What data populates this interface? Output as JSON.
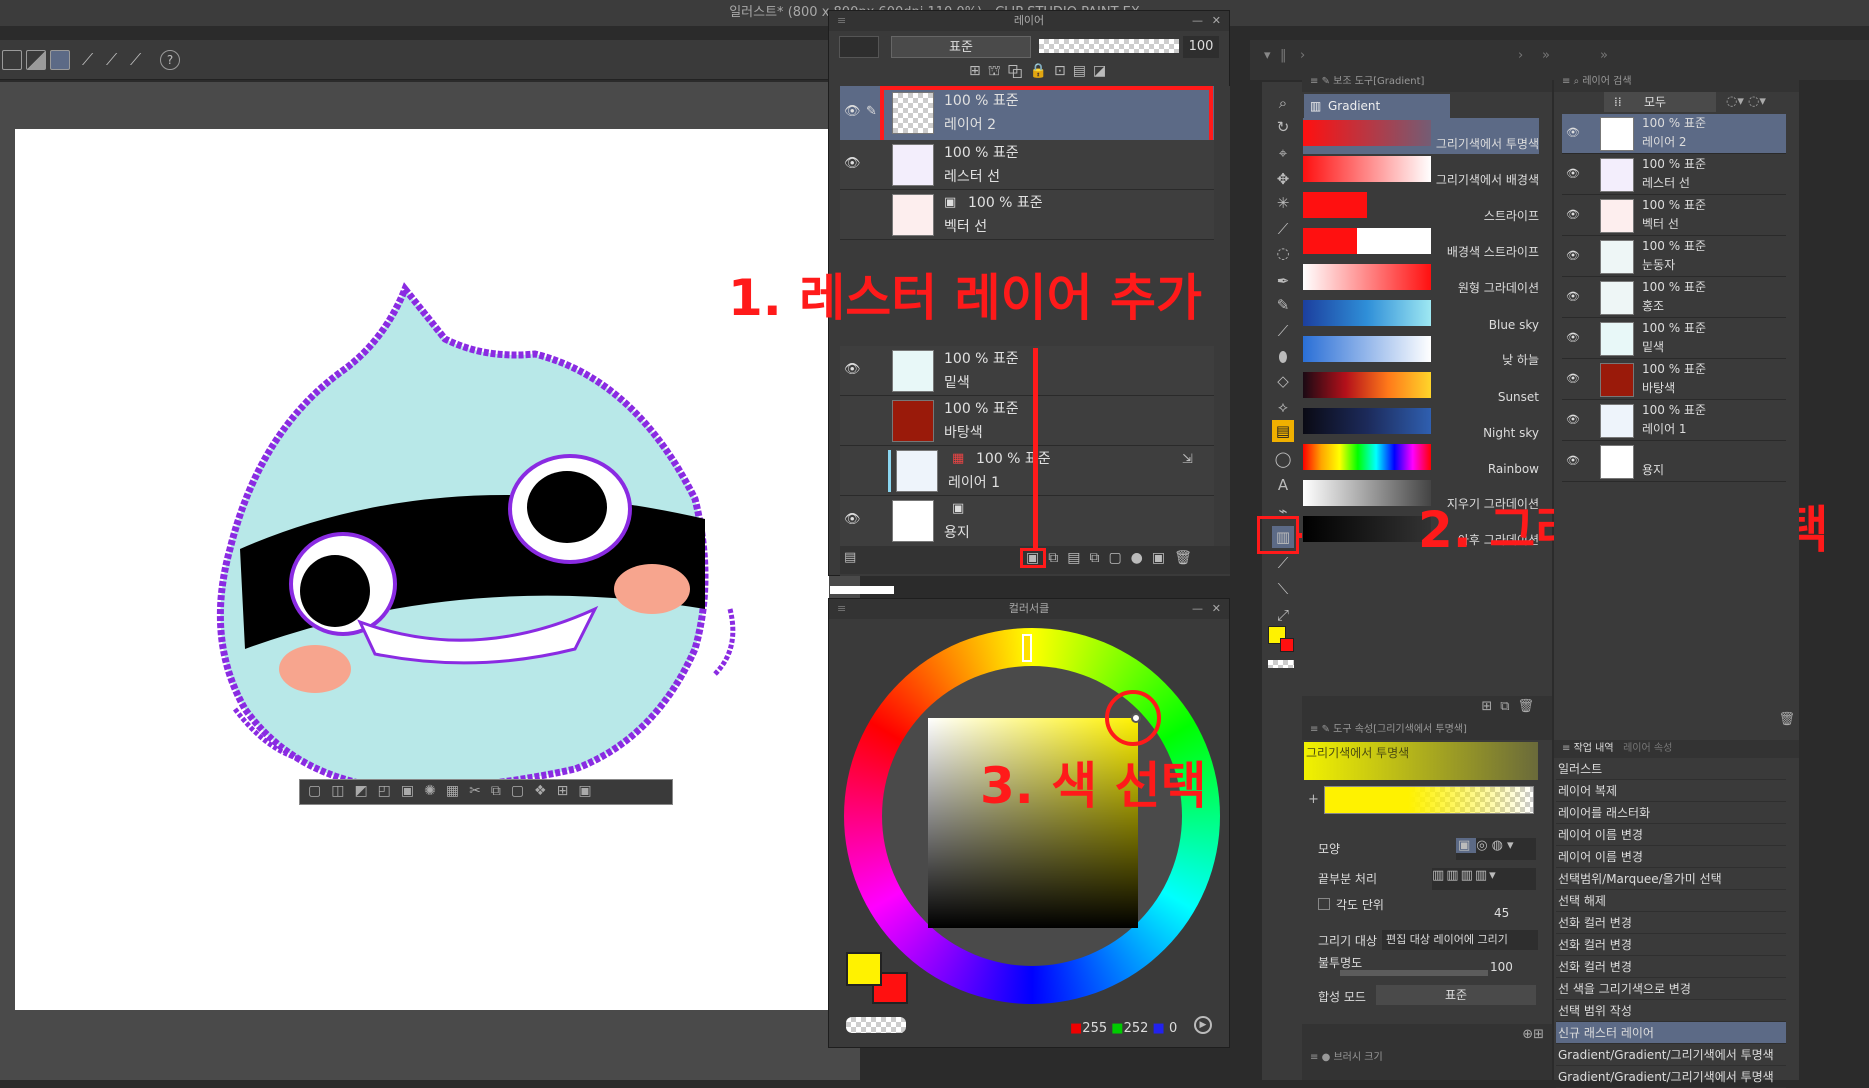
{
  "window": {
    "title": "일러스트* (800 x 800px 600dpi 110.0%)  - CLIP STUDIO PAINT EX"
  },
  "layer_panel": {
    "title": "레이어",
    "blend_mode": "표준",
    "opacity": "100",
    "layers": [
      {
        "opacity": "100 % 표준",
        "name": "레이어 2",
        "selected": true
      },
      {
        "opacity": "100 % 표준",
        "name": "레스터 선"
      },
      {
        "opacity": "100 % 표준",
        "name": "벡터 선"
      },
      {
        "opacity": "100 % 표준",
        "name": "밑색"
      },
      {
        "opacity": "100 % 표준",
        "name": "바탕색"
      },
      {
        "opacity": "100 % 표준",
        "name": "레이어 1"
      },
      {
        "opacity": "",
        "name": "용지"
      }
    ]
  },
  "color_panel": {
    "title": "컬러서클",
    "r": "255",
    "g": "252",
    "b": "0"
  },
  "sub_tool_panel": {
    "header": "보조 도구[Gradient]",
    "group": "Gradient",
    "gradients": [
      {
        "label": "그리기색에서 투명색",
        "css": "linear-gradient(90deg,#ff1010,rgba(255,16,16,0.15))"
      },
      {
        "label": "그리기색에서 배경색",
        "css": "linear-gradient(90deg,#ff1010,#ffffff)"
      },
      {
        "label": "스트라이프",
        "css": "linear-gradient(90deg,#ff1010 50%,transparent 50%)"
      },
      {
        "label": "배경색 스트라이프",
        "css": "linear-gradient(90deg,#ff1010 42%,#ffffff 42%)"
      },
      {
        "label": "원형 그라데이션",
        "css": "linear-gradient(90deg,#ffffff,#ff1010)"
      },
      {
        "label": "Blue sky",
        "css": "linear-gradient(90deg,#1c3f9e,#2f8fd8,#9ee8f2)"
      },
      {
        "label": "낮 하늘",
        "css": "linear-gradient(90deg,#2a6fd6,#ffffff)"
      },
      {
        "label": "Sunset",
        "css": "linear-gradient(90deg,#1a0a14,#b3101a,#ff7a1a,#ffd52a)"
      },
      {
        "label": "Night sky",
        "css": "linear-gradient(90deg,#0a0a14,#1c2a5a,#2f5fb0)"
      },
      {
        "label": "Rainbow",
        "css": "linear-gradient(90deg,#ff0000,#ffa500,#ffff00,#00ff00,#00ffff,#0000ff,#ff00ff,#ff0000)"
      },
      {
        "label": "지우기 그라데이션",
        "css": "linear-gradient(90deg,#ffffff,#444444)"
      },
      {
        "label": "아후 그라데이션",
        "css": "linear-gradient(90deg,#000000,#333333)"
      }
    ]
  },
  "tool_property": {
    "header": "도구 속성[그리기색에서 투명색]",
    "preset": "그리기색에서 투명색",
    "rows": [
      {
        "label": "모양"
      },
      {
        "label": "끝부분 처리"
      },
      {
        "label": "각도 단위",
        "value": "45"
      },
      {
        "label": "그리기 대상",
        "value": "편집 대상 레이어에 그리기"
      },
      {
        "label": "불투명도",
        "value": "100"
      },
      {
        "label": "합성 모드",
        "value": "표준"
      }
    ],
    "brush_size_header": "브러시 크기"
  },
  "layer_search": {
    "header": "레이어 검색",
    "filter": "모두",
    "layers": [
      {
        "line1": "100 % 표준",
        "line2": "레이어 2",
        "selected": true
      },
      {
        "line1": "100 % 표준",
        "line2": "레스터 선"
      },
      {
        "line1": "100 % 표준",
        "line2": "벡터 선"
      },
      {
        "line1": "100 % 표준",
        "line2": "눈동자"
      },
      {
        "line1": "100 % 표준",
        "line2": "홍조"
      },
      {
        "line1": "100 % 표준",
        "line2": "밑색"
      },
      {
        "line1": "100 % 표준",
        "line2": "바탕색"
      },
      {
        "line1": "100 % 표준",
        "line2": "레이어 1"
      },
      {
        "line1": "",
        "line2": "용지"
      }
    ]
  },
  "history": {
    "tabs": [
      "작업 내역",
      "레이어 속성"
    ],
    "items": [
      {
        "label": "일러스트"
      },
      {
        "label": "레이어 복제"
      },
      {
        "label": "레이어를 래스터화"
      },
      {
        "label": "레이어 이름 변경"
      },
      {
        "label": "레이어 이름 변경"
      },
      {
        "label": "선택범위/Marquee/올가미 선택"
      },
      {
        "label": "선택 해제"
      },
      {
        "label": "선화 컬러 변경"
      },
      {
        "label": "선화 컬러 변경"
      },
      {
        "label": "선화 컬러 변경"
      },
      {
        "label": "선 색을 그리기색으로 변경"
      },
      {
        "label": "선택 범위 작성"
      },
      {
        "label": "신규 래스터 레이어",
        "selected": true
      },
      {
        "label": "Gradient/Gradient/그리기색에서 투명색"
      },
      {
        "label": "Gradient/Gradient/그리기색에서 투명색"
      }
    ]
  },
  "annotations": {
    "step1": "1. 레스터 레이어 추가",
    "step2": "2. 그라디언트 선택",
    "step3": "3. 색 선택"
  },
  "colors": {
    "main": "#fff200",
    "sub": "#ff1010",
    "accent_red": "#ff1a1a",
    "selection": "#8a2be2"
  }
}
